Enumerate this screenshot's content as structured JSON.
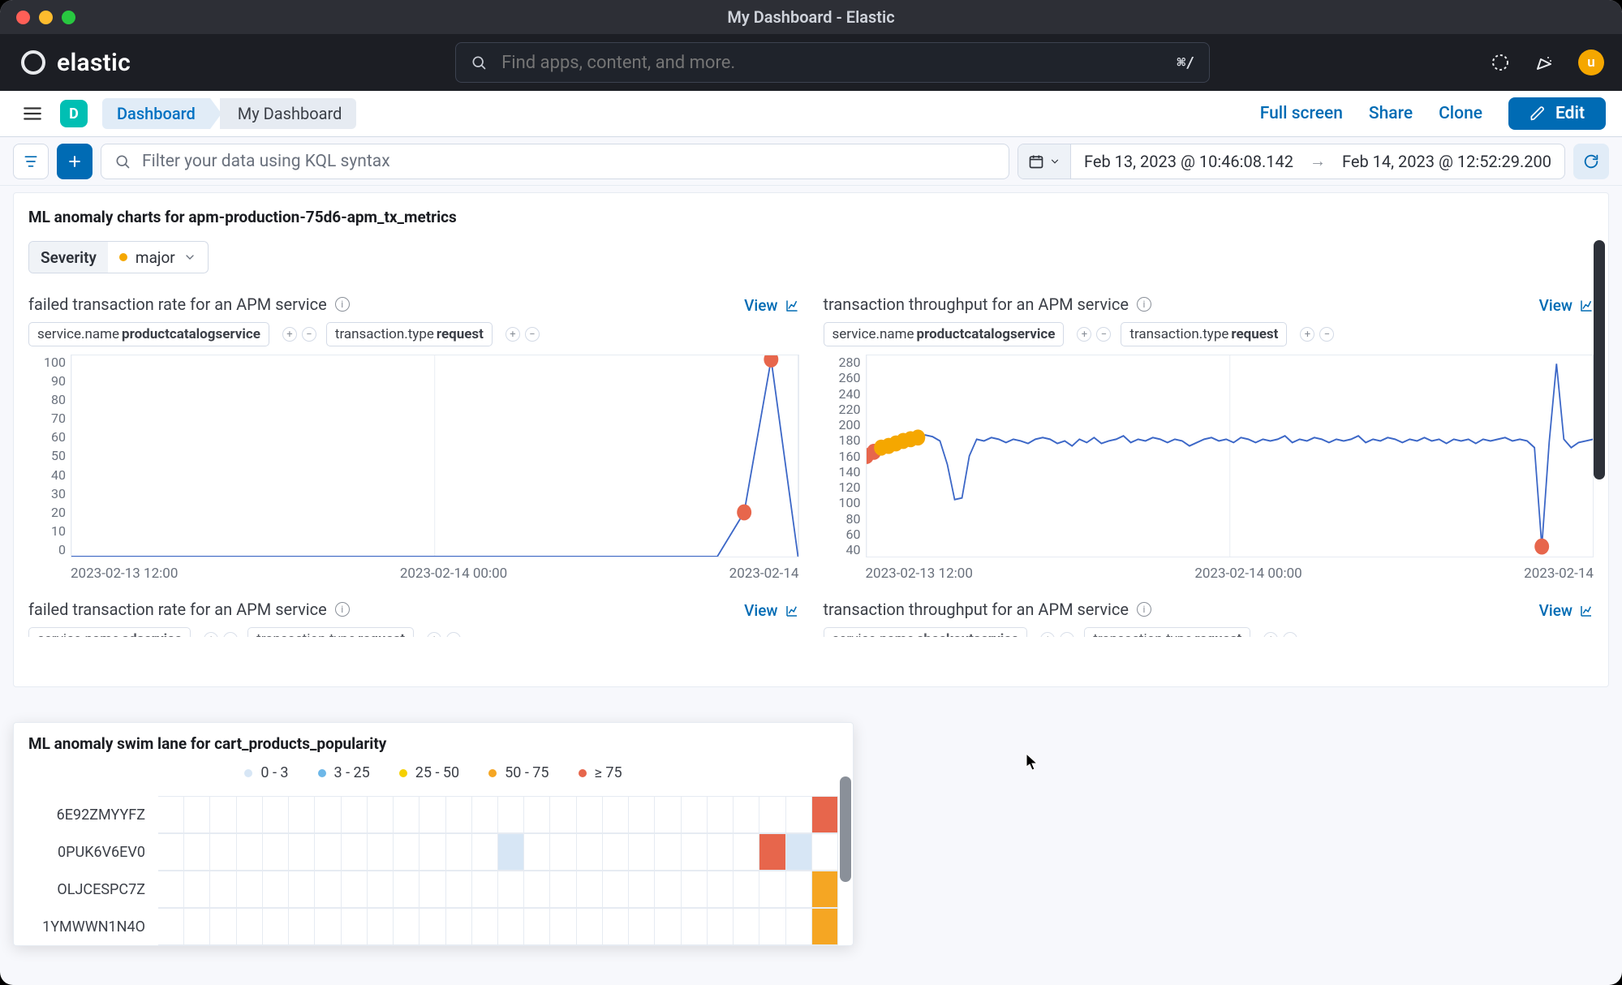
{
  "window": {
    "title": "My Dashboard - Elastic"
  },
  "brand": {
    "name": "elastic"
  },
  "search": {
    "placeholder": "Find apps, content, and more.",
    "hint": "⌘/"
  },
  "avatar": {
    "initial": "u"
  },
  "space": {
    "initial": "D"
  },
  "breadcrumb": {
    "parent": "Dashboard",
    "current": "My Dashboard"
  },
  "actions": {
    "fullscreen": "Full screen",
    "share": "Share",
    "clone": "Clone",
    "edit": "Edit"
  },
  "filter": {
    "kql_placeholder": "Filter your data using KQL syntax",
    "date_from": "Feb 13, 2023 @ 10:46:08.142",
    "date_to": "Feb 14, 2023 @ 12:52:29.200"
  },
  "anomaly_panel": {
    "title": "ML anomaly charts for apm-production-75d6-apm_tx_metrics",
    "severity_label": "Severity",
    "severity_value": "major",
    "view_label": "View",
    "charts": [
      {
        "title": "failed transaction rate for an APM service",
        "filters": [
          {
            "key": "service.name",
            "value": "productcatalogservice"
          },
          {
            "key": "transaction.type",
            "value": "request"
          }
        ]
      },
      {
        "title": "transaction throughput for an APM service",
        "filters": [
          {
            "key": "service.name",
            "value": "productcatalogservice"
          },
          {
            "key": "transaction.type",
            "value": "request"
          }
        ]
      }
    ],
    "charts_row2": [
      {
        "title": "failed transaction rate for an APM service",
        "filters": [
          {
            "key": "service.name",
            "value": "adservice"
          },
          {
            "key": "transaction.type",
            "value": "request"
          }
        ]
      },
      {
        "title": "transaction throughput for an APM service",
        "filters": [
          {
            "key": "service.name",
            "value": "checkoutservice"
          },
          {
            "key": "transaction.type",
            "value": "request"
          }
        ]
      }
    ]
  },
  "chart_data": [
    {
      "type": "line",
      "title": "failed transaction rate for an APM service",
      "ylabel": "",
      "xlabel": "",
      "ylim": [
        0,
        100
      ],
      "y_ticks": [
        0,
        10,
        20,
        30,
        40,
        50,
        60,
        70,
        80,
        90,
        100
      ],
      "x_ticks": [
        "2023-02-13 12:00",
        "2023-02-14 00:00",
        "2023-02-14"
      ],
      "x": [
        0,
        1,
        2,
        3,
        4,
        5,
        6,
        7,
        8,
        9,
        10,
        11,
        12,
        13,
        14,
        15,
        16,
        17,
        18,
        19,
        20,
        21,
        22,
        23,
        24,
        25,
        26,
        27
      ],
      "values": [
        0,
        0,
        0,
        0,
        0,
        0,
        0,
        0,
        0,
        0,
        0,
        0,
        0,
        0,
        0,
        0,
        0,
        0,
        0,
        0,
        0,
        0,
        0,
        0,
        0,
        22,
        98,
        0
      ],
      "anomalies": [
        {
          "x_index": 25,
          "value": 22,
          "severity": "critical"
        },
        {
          "x_index": 26,
          "value": 98,
          "severity": "critical"
        }
      ]
    },
    {
      "type": "line",
      "title": "transaction throughput for an APM service",
      "ylabel": "",
      "xlabel": "",
      "ylim": [
        40,
        280
      ],
      "y_ticks": [
        40,
        60,
        80,
        100,
        120,
        140,
        160,
        180,
        200,
        220,
        240,
        260,
        280
      ],
      "x_ticks": [
        "2023-02-13 12:00",
        "2023-02-14 00:00",
        "2023-02-14"
      ],
      "x": [
        0,
        1,
        2,
        3,
        4,
        5,
        6,
        7,
        8,
        9,
        10,
        11,
        12,
        13,
        14,
        15,
        16,
        17,
        18,
        19,
        20,
        21,
        22,
        23,
        24,
        25,
        26,
        27,
        28,
        29,
        30,
        31,
        32,
        33,
        34,
        35,
        36,
        37,
        38,
        39,
        40,
        41,
        42,
        43,
        44,
        45,
        46,
        47,
        48,
        49,
        50,
        51,
        52,
        53,
        54,
        55,
        56,
        57,
        58,
        59,
        60,
        61,
        62,
        63,
        64,
        65,
        66,
        67,
        68,
        69,
        70,
        71,
        72,
        73,
        74,
        75,
        76,
        77,
        78,
        79,
        80,
        81,
        82,
        83,
        84,
        85,
        86,
        87,
        88,
        89,
        90,
        91,
        92,
        93,
        94,
        95,
        96,
        97,
        98,
        99
      ],
      "values": [
        160,
        165,
        170,
        172,
        175,
        178,
        180,
        182,
        185,
        183,
        178,
        150,
        108,
        110,
        160,
        180,
        178,
        182,
        180,
        176,
        180,
        178,
        175,
        180,
        182,
        180,
        175,
        178,
        172,
        180,
        176,
        182,
        175,
        178,
        180,
        184,
        176,
        180,
        178,
        182,
        180,
        176,
        180,
        178,
        172,
        176,
        180,
        182,
        178,
        180,
        176,
        182,
        180,
        176,
        180,
        178,
        180,
        184,
        176,
        180,
        178,
        182,
        180,
        176,
        180,
        178,
        180,
        184,
        176,
        180,
        178,
        182,
        180,
        176,
        180,
        178,
        182,
        178,
        180,
        175,
        180,
        178,
        180,
        175,
        180,
        178,
        180,
        182,
        178,
        180,
        178,
        170,
        52,
        176,
        270,
        180,
        170,
        176,
        178,
        180
      ],
      "anomalies": [
        {
          "x_index": 0,
          "value": 160,
          "severity": "critical"
        },
        {
          "x_index": 1,
          "value": 165,
          "severity": "critical"
        },
        {
          "x_index": 2,
          "value": 170,
          "severity": "major"
        },
        {
          "x_index": 3,
          "value": 172,
          "severity": "major"
        },
        {
          "x_index": 4,
          "value": 175,
          "severity": "major"
        },
        {
          "x_index": 5,
          "value": 178,
          "severity": "major"
        },
        {
          "x_index": 6,
          "value": 180,
          "severity": "major"
        },
        {
          "x_index": 7,
          "value": 182,
          "severity": "major"
        },
        {
          "x_index": 92,
          "value": 52,
          "severity": "critical"
        }
      ]
    }
  ],
  "swimlane": {
    "title": "ML anomaly swim lane for cart_products_popularity",
    "legend": [
      {
        "label": "0 - 3",
        "color": "#d7e6f5"
      },
      {
        "label": "3 - 25",
        "color": "#6db7e8"
      },
      {
        "label": "25 - 50",
        "color": "#f5d000"
      },
      {
        "label": "50 - 75",
        "color": "#f5a623"
      },
      {
        "label": "≥ 75",
        "color": "#e7664c"
      }
    ],
    "rows": [
      {
        "label": "6E92ZMYYFZ",
        "cells": {
          "25": "red"
        }
      },
      {
        "label": "0PUK6V6EV0",
        "cells": {
          "13": "blue",
          "23": "red",
          "24": "blue"
        }
      },
      {
        "label": "OLJCESPC7Z",
        "cells": {
          "25": "orange"
        }
      },
      {
        "label": "1YMWWN1N4O",
        "cells": {
          "25": "orange"
        }
      }
    ],
    "columns": 26
  }
}
